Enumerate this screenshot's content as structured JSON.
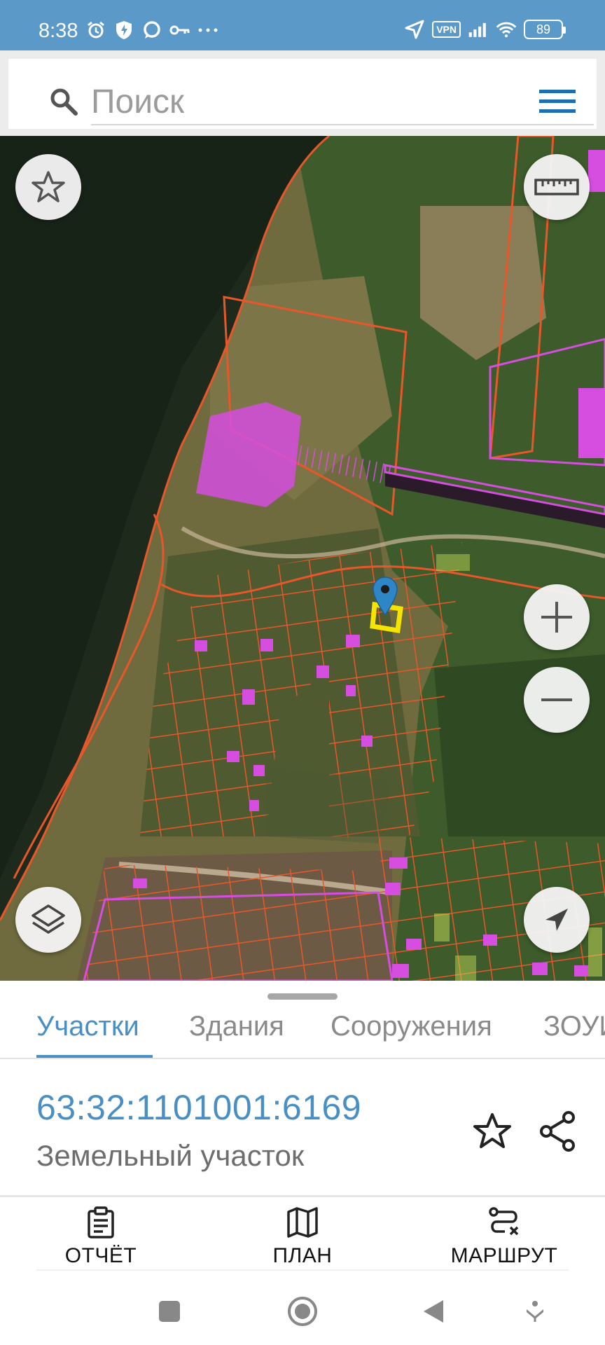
{
  "status_bar": {
    "time": "8:38",
    "vpn": "VPN",
    "battery": "89",
    "left_icons": [
      "alarm-icon",
      "shield-bolt-icon",
      "chat-icon",
      "key-icon",
      "more-dots-icon"
    ],
    "right_icons": [
      "location-arrow-icon",
      "vpn-badge",
      "signal-icon",
      "wifi-icon",
      "battery-icon"
    ]
  },
  "search": {
    "placeholder": "Поиск",
    "value": ""
  },
  "map": {
    "buttons": [
      "favorite-star-icon",
      "ruler-icon",
      "zoom-in-icon",
      "zoom-out-icon",
      "layers-icon",
      "my-location-icon"
    ],
    "marker": "location-pin-icon",
    "colors": {
      "parcel_border": "#e8572a",
      "building_fill": "#d64ee0",
      "selected_parcel": "#f5e300",
      "marker": "#2f86c7",
      "water": "#1e2a1c"
    }
  },
  "tabs": [
    {
      "label": "Участки",
      "active": true
    },
    {
      "label": "Здания",
      "active": false
    },
    {
      "label": "Сооружения",
      "active": false
    },
    {
      "label": "ЗОУИТ",
      "active": false
    }
  ],
  "parcel": {
    "number": "63:32:1101001:6169",
    "type": "Земельный участок"
  },
  "actions": [
    {
      "label": "ОТЧЁТ",
      "icon": "clipboard-icon"
    },
    {
      "label": "ПЛАН",
      "icon": "map-icon"
    },
    {
      "label": "МАРШРУТ",
      "icon": "route-icon"
    }
  ],
  "colors": {
    "accent": "#4a8fc3",
    "status_bar": "#5b9ac8"
  },
  "navbar": [
    "recent-apps-icon",
    "home-icon",
    "back-icon",
    "assistant-icon"
  ]
}
